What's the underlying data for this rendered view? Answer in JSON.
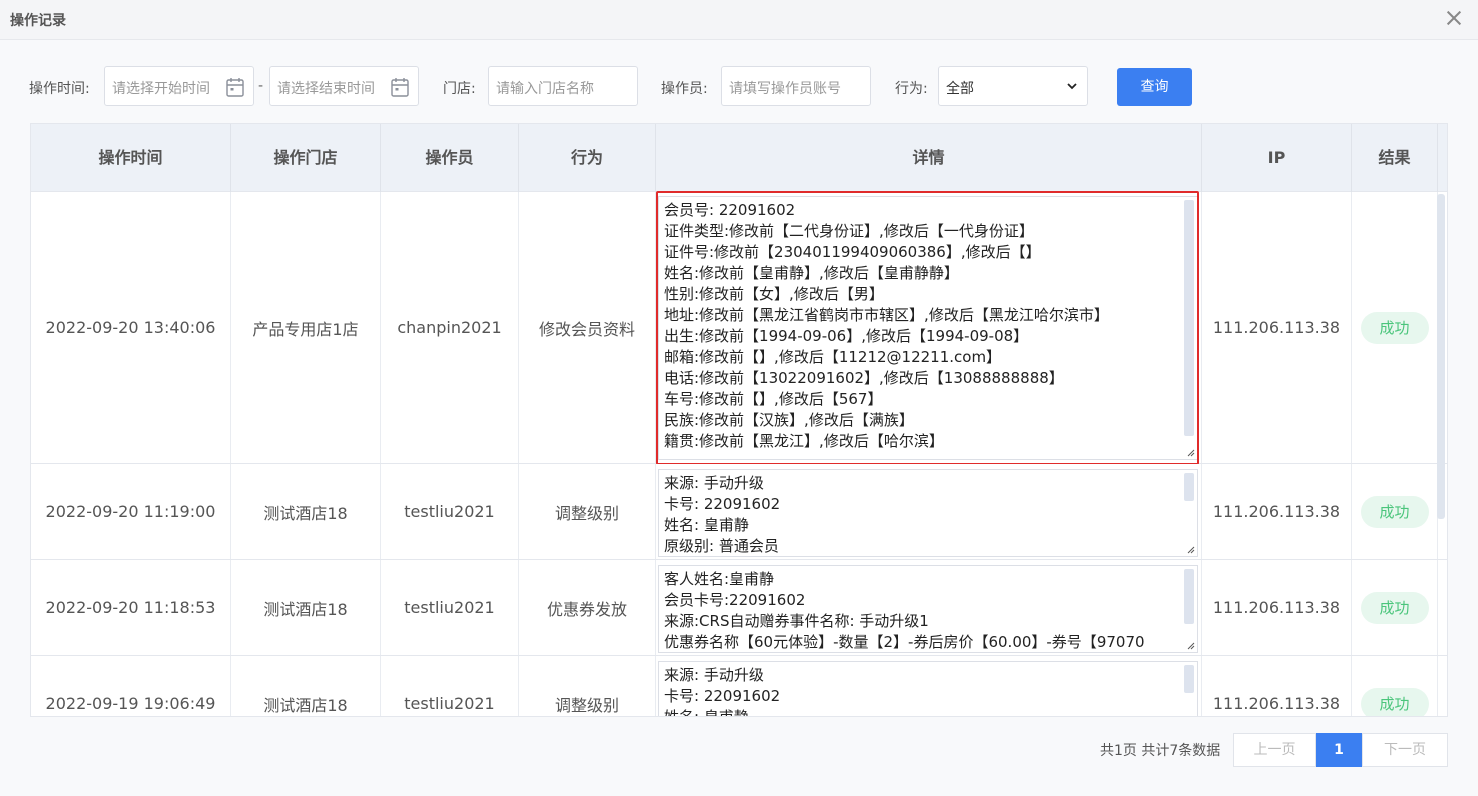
{
  "dialog": {
    "title": "操作记录"
  },
  "filters": {
    "time_label": "操作时间:",
    "start_placeholder": "请选择开始时间",
    "end_placeholder": "请选择结束时间",
    "separator": "-",
    "store_label": "门店:",
    "store_placeholder": "请输入门店名称",
    "operator_label": "操作员:",
    "operator_placeholder": "请填写操作员账号",
    "action_label": "行为:",
    "action_selected": "全部",
    "search_label": "查询"
  },
  "table": {
    "headers": [
      "操作时间",
      "操作门店",
      "操作员",
      "行为",
      "详情",
      "IP",
      "结果"
    ],
    "rows": [
      {
        "time": "2022-09-20 13:40:06",
        "store": "产品专用店1店",
        "operator": "chanpin2021",
        "action": "修改会员资料",
        "details": [
          "会员号: 22091602",
          "证件类型:修改前【二代身份证】,修改后【一代身份证】",
          "证件号:修改前【230401199409060386】,修改后【】",
          "姓名:修改前【皇甫静】,修改后【皇甫静静】",
          "性别:修改前【女】,修改后【男】",
          "地址:修改前【黑龙江省鹤岗市市辖区】,修改后【黑龙江哈尔滨市】",
          "出生:修改前【1994-09-06】,修改后【1994-09-08】",
          "邮箱:修改前【】,修改后【11212@12211.com】",
          "电话:修改前【13022091602】,修改后【13088888888】",
          "车号:修改前【】,修改后【567】",
          "民族:修改前【汉族】,修改后【满族】",
          "籍贯:修改前【黑龙江】,修改后【哈尔滨】"
        ],
        "ip": "111.206.113.38",
        "result": "成功"
      },
      {
        "time": "2022-09-20 11:19:00",
        "store": "测试酒店18",
        "operator": "testliu2021",
        "action": "调整级别",
        "details": [
          "来源: 手动升级",
          "卡号: 22091602",
          "姓名: 皇甫静",
          "原级别: 普通会员"
        ],
        "ip": "111.206.113.38",
        "result": "成功"
      },
      {
        "time": "2022-09-20 11:18:53",
        "store": "测试酒店18",
        "operator": "testliu2021",
        "action": "优惠券发放",
        "details": [
          "客人姓名:皇甫静",
          "会员卡号:22091602",
          "来源:CRS自动赠券事件名称: 手动升级1",
          "优惠券名称【60元体验】-数量【2】-券后房价【60.00】-券号【97070"
        ],
        "ip": "111.206.113.38",
        "result": "成功"
      },
      {
        "time": "2022-09-19 19:06:49",
        "store": "测试酒店18",
        "operator": "testliu2021",
        "action": "调整级别",
        "details": [
          "来源: 手动升级",
          "卡号: 22091602",
          "姓名: 皇甫静"
        ],
        "ip": "111.206.113.38",
        "result": "成功"
      }
    ]
  },
  "pagination": {
    "summary": "共1页 共计7条数据",
    "prev_label": "上一页",
    "current_page": "1",
    "next_label": "下一页"
  },
  "colors": {
    "accent": "#3b7ff1",
    "success_bg": "#e7f7ee",
    "success_text": "#4ac57b",
    "highlight": "#e02b2b"
  }
}
